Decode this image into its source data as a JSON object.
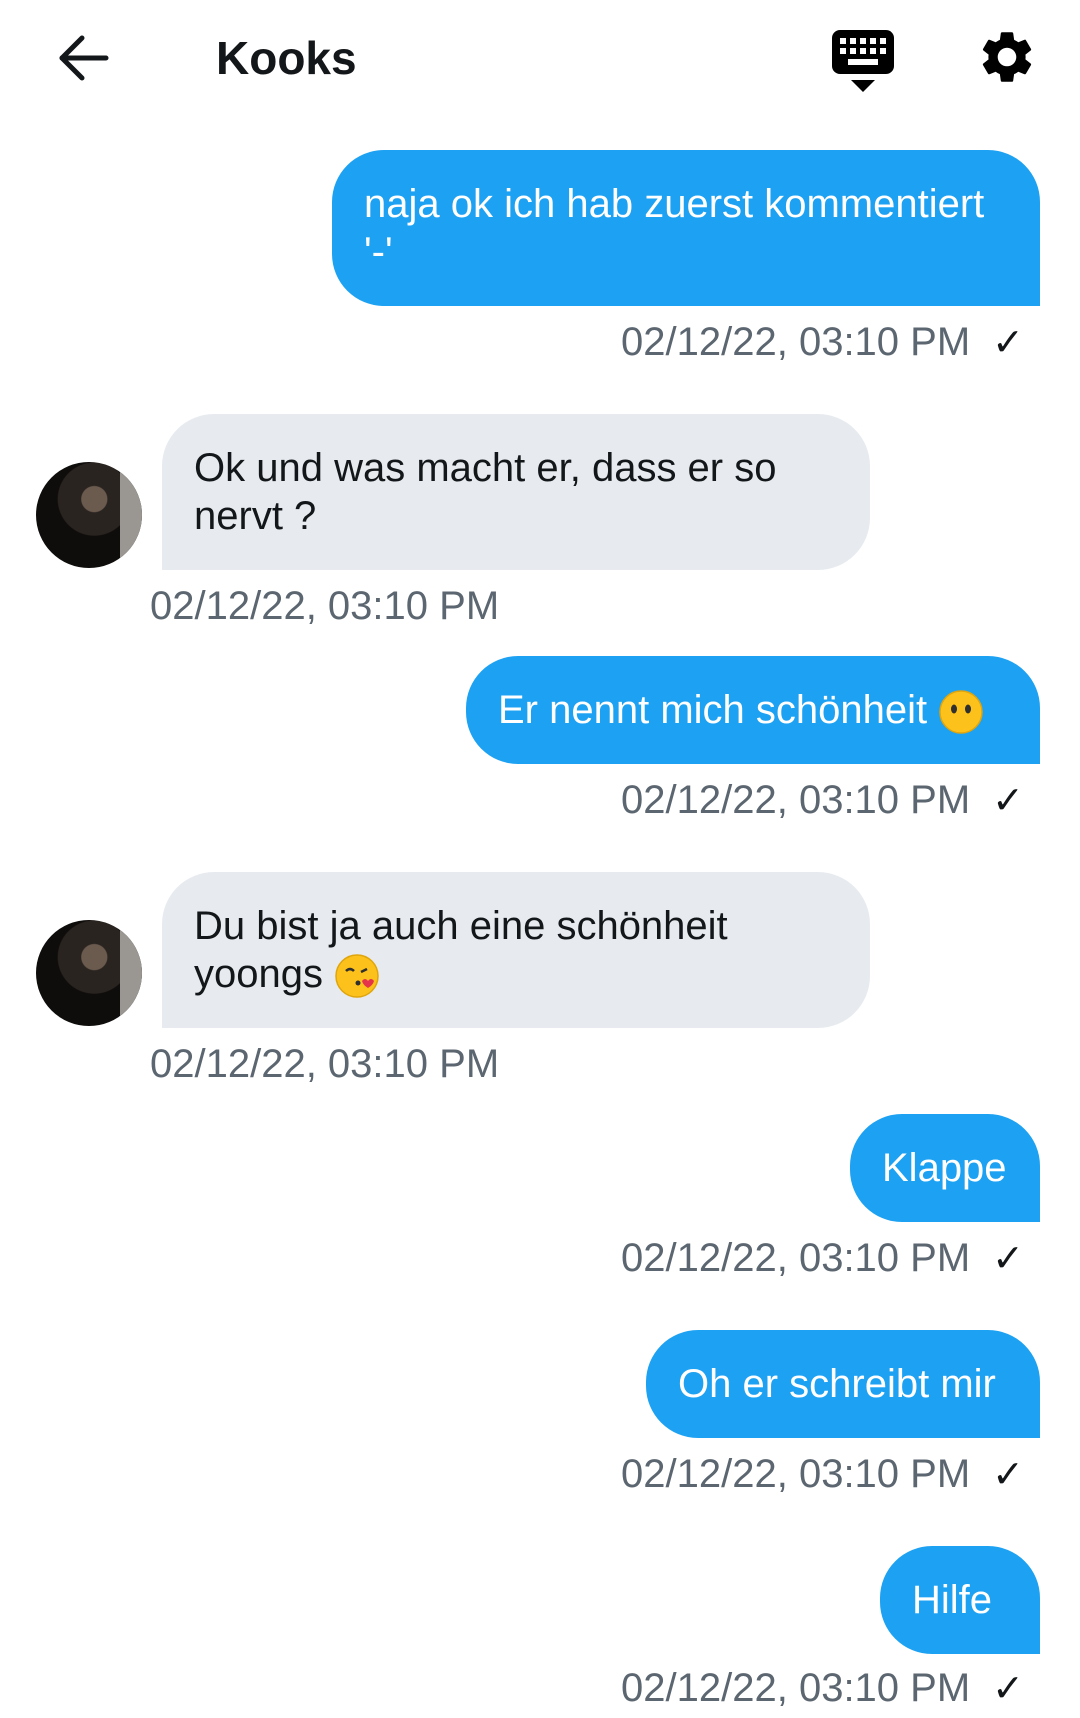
{
  "header": {
    "title": "Kooks",
    "back_icon": "arrow-left-icon",
    "keyboard_icon": "keyboard-icon",
    "settings_icon": "gear-icon"
  },
  "colors": {
    "outgoing_bubble": "#1da1f2",
    "incoming_bubble": "#e7ebef",
    "timestamp": "#5b6670"
  },
  "messages": [
    {
      "direction": "out",
      "text": "naja ok ich hab zuerst kommentiert '-'",
      "timestamp": "02/12/22, 03:10 PM",
      "status_icon": "check-icon"
    },
    {
      "direction": "in",
      "text": "Ok und was macht er, dass er so nervt ?",
      "timestamp": "02/12/22, 03:10 PM"
    },
    {
      "direction": "out",
      "text": "Er nennt mich schönheit",
      "emoji": "neutral-face-icon",
      "timestamp": "02/12/22, 03:10 PM",
      "status_icon": "check-icon"
    },
    {
      "direction": "in",
      "text": "Du bist ja auch eine schönheit yoongs",
      "emoji": "kissing-face-icon",
      "timestamp": "02/12/22, 03:10 PM"
    },
    {
      "direction": "out",
      "text": "Klappe",
      "timestamp": "02/12/22, 03:10 PM",
      "status_icon": "check-icon"
    },
    {
      "direction": "out",
      "text": "Oh er schreibt mir",
      "timestamp": "02/12/22, 03:10 PM",
      "status_icon": "check-icon"
    },
    {
      "direction": "out",
      "text": "Hilfe",
      "timestamp": "02/12/22, 03:10 PM",
      "status_icon": "check-icon"
    }
  ],
  "check_glyph": "✓"
}
